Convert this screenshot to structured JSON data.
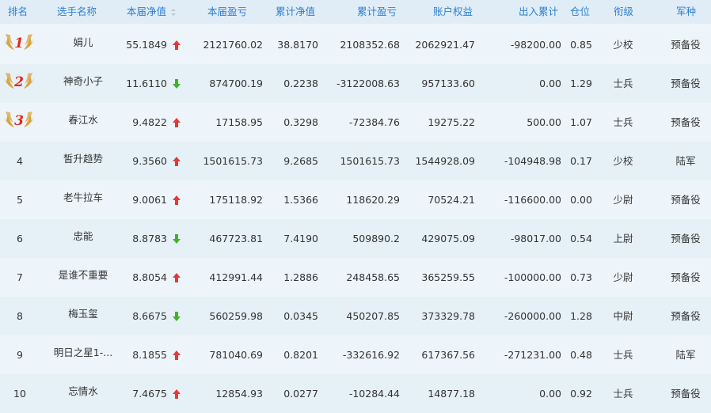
{
  "header": {
    "rank": "排名",
    "name": "选手名称",
    "cur_nav": "本届净值",
    "cur_pnl": "本届盈亏",
    "cum_nav": "累计净值",
    "cum_pnl": "累计盈亏",
    "equity": "账户权益",
    "in_out": "出入累计",
    "position": "仓位",
    "title": "衔级",
    "army": "军种"
  },
  "colors": {
    "header_text": "#2f7fd1",
    "up": "#e53935",
    "down": "#43b02a",
    "medal_gold": "#d9a441",
    "medal_red": "#e0281c"
  },
  "rows": [
    {
      "rank": "1",
      "medal": true,
      "name": "娟儿",
      "cur_nav": "55.1849",
      "trend": "up",
      "cur_pnl": "2121760.02",
      "cum_nav": "38.8170",
      "cum_pnl": "2108352.68",
      "equity": "2062921.47",
      "in_out": "-98200.00",
      "position": "0.85",
      "title": "少校",
      "army": "预备役"
    },
    {
      "rank": "2",
      "medal": true,
      "name": "神奇小子",
      "cur_nav": "11.6110",
      "trend": "down",
      "cur_pnl": "874700.19",
      "cum_nav": "0.2238",
      "cum_pnl": "-3122008.63",
      "equity": "957133.60",
      "in_out": "0.00",
      "position": "1.29",
      "title": "士兵",
      "army": "预备役"
    },
    {
      "rank": "3",
      "medal": true,
      "name": "春江水",
      "cur_nav": "9.4822",
      "trend": "up",
      "cur_pnl": "17158.95",
      "cum_nav": "0.3298",
      "cum_pnl": "-72384.76",
      "equity": "19275.22",
      "in_out": "500.00",
      "position": "1.07",
      "title": "士兵",
      "army": "预备役"
    },
    {
      "rank": "4",
      "medal": false,
      "name": "皙升趋势",
      "cur_nav": "9.3560",
      "trend": "up",
      "cur_pnl": "1501615.73",
      "cum_nav": "9.2685",
      "cum_pnl": "1501615.73",
      "equity": "1544928.09",
      "in_out": "-104948.98",
      "position": "0.17",
      "title": "少校",
      "army": "陆军"
    },
    {
      "rank": "5",
      "medal": false,
      "name": "老牛拉车",
      "cur_nav": "9.0061",
      "trend": "up",
      "cur_pnl": "175118.92",
      "cum_nav": "1.5366",
      "cum_pnl": "118620.29",
      "equity": "70524.21",
      "in_out": "-116600.00",
      "position": "0.00",
      "title": "少尉",
      "army": "预备役"
    },
    {
      "rank": "6",
      "medal": false,
      "name": "忠能",
      "cur_nav": "8.8783",
      "trend": "down",
      "cur_pnl": "467723.81",
      "cum_nav": "7.4190",
      "cum_pnl": "509890.2",
      "equity": "429075.09",
      "in_out": "-98017.00",
      "position": "0.54",
      "title": "上尉",
      "army": "预备役"
    },
    {
      "rank": "7",
      "medal": false,
      "name": "是谁不重要",
      "cur_nav": "8.8054",
      "trend": "up",
      "cur_pnl": "412991.44",
      "cum_nav": "1.2886",
      "cum_pnl": "248458.65",
      "equity": "365259.55",
      "in_out": "-100000.00",
      "position": "0.73",
      "title": "少尉",
      "army": "预备役"
    },
    {
      "rank": "8",
      "medal": false,
      "name": "梅玉玺",
      "cur_nav": "8.6675",
      "trend": "down",
      "cur_pnl": "560259.98",
      "cum_nav": "0.0345",
      "cum_pnl": "450207.85",
      "equity": "373329.78",
      "in_out": "-260000.00",
      "position": "1.28",
      "title": "中尉",
      "army": "预备役"
    },
    {
      "rank": "9",
      "medal": false,
      "name": "明日之星1-...",
      "cur_nav": "8.1855",
      "trend": "up",
      "cur_pnl": "781040.69",
      "cum_nav": "0.8201",
      "cum_pnl": "-332616.92",
      "equity": "617367.56",
      "in_out": "-271231.00",
      "position": "0.48",
      "title": "士兵",
      "army": "陆军"
    },
    {
      "rank": "10",
      "medal": false,
      "name": "忘情水",
      "cur_nav": "7.4675",
      "trend": "up",
      "cur_pnl": "12854.93",
      "cum_nav": "0.0277",
      "cum_pnl": "-10284.44",
      "equity": "14877.18",
      "in_out": "0.00",
      "position": "0.92",
      "title": "士兵",
      "army": "预备役"
    }
  ]
}
